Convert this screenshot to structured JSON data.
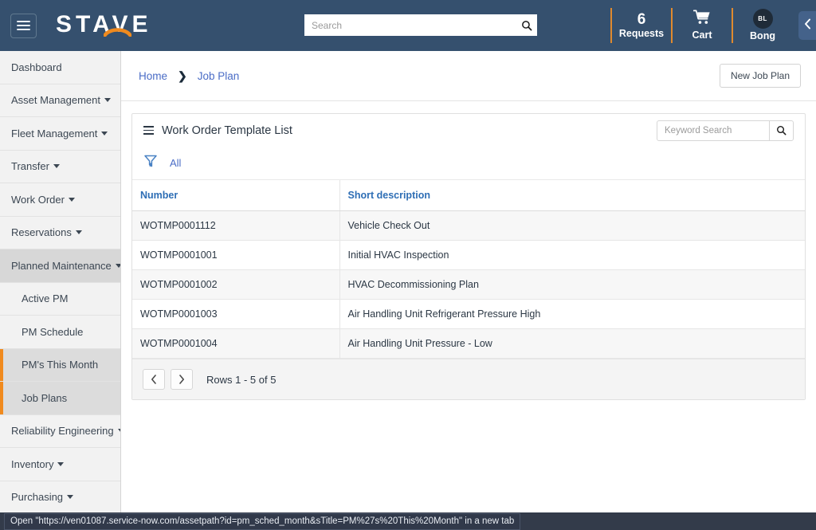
{
  "header": {
    "menu_icon": "hamburger-icon",
    "brand": "STAVE",
    "search": {
      "value": "",
      "placeholder": "Search",
      "icon": "search-icon"
    },
    "requests": {
      "count": "6",
      "label": "Requests"
    },
    "cart": {
      "label": "Cart",
      "icon": "cart-icon"
    },
    "user": {
      "initials": "BL",
      "name": "Bong",
      "avatar": "avatar-icon"
    },
    "collapse_icon": "chevron-left-icon",
    "background_color": "#35506e",
    "accent_color": "#e08a2e"
  },
  "sidebar": {
    "items": [
      {
        "label": "Dashboard",
        "has_caret": false,
        "level": "top",
        "state": "normal"
      },
      {
        "label": "Asset Management",
        "has_caret": true,
        "level": "top",
        "state": "normal"
      },
      {
        "label": "Fleet Management",
        "has_caret": true,
        "level": "top",
        "state": "normal"
      },
      {
        "label": "Transfer",
        "has_caret": true,
        "level": "top",
        "state": "normal"
      },
      {
        "label": "Work Order",
        "has_caret": true,
        "level": "top",
        "state": "normal"
      },
      {
        "label": "Reservations",
        "has_caret": true,
        "level": "top",
        "state": "normal"
      },
      {
        "label": "Planned Maintenance",
        "has_caret": true,
        "level": "top",
        "state": "expanded"
      },
      {
        "label": "Active PM",
        "has_caret": false,
        "level": "sub",
        "state": "normal"
      },
      {
        "label": "PM Schedule",
        "has_caret": false,
        "level": "sub",
        "state": "normal"
      },
      {
        "label": "PM's This Month",
        "has_caret": false,
        "level": "sub",
        "state": "highlighted"
      },
      {
        "label": "Job Plans",
        "has_caret": false,
        "level": "sub",
        "state": "highlighted"
      },
      {
        "label": "Reliability Engineering",
        "has_caret": true,
        "level": "top",
        "state": "normal"
      },
      {
        "label": "Inventory",
        "has_caret": true,
        "level": "top",
        "state": "normal"
      },
      {
        "label": "Purchasing",
        "has_caret": true,
        "level": "top",
        "state": "normal"
      }
    ],
    "highlight_accent": "#f08a1e"
  },
  "breadcrumb": {
    "home": "Home",
    "separator": "❯",
    "current": "Job Plan",
    "link_color": "#4a6cc6"
  },
  "actions": {
    "new_job_plan": "New Job Plan"
  },
  "list_card": {
    "menu_icon": "list-menu-icon",
    "title": "Work Order Template List",
    "keyword_search": {
      "value": "",
      "placeholder": "Keyword Search",
      "icon": "search-icon"
    },
    "filter": {
      "icon": "funnel-filter-icon",
      "label": "All"
    },
    "columns": [
      {
        "key": "number",
        "label": "Number"
      },
      {
        "key": "short_description",
        "label": "Short description"
      }
    ],
    "rows": [
      {
        "number": "WOTMP0001112",
        "short_description": "Vehicle Check Out"
      },
      {
        "number": "WOTMP0001001",
        "short_description": "Initial HVAC Inspection"
      },
      {
        "number": "WOTMP0001002",
        "short_description": "HVAC Decommissioning Plan"
      },
      {
        "number": "WOTMP0001003",
        "short_description": "Air Handling Unit Refrigerant Pressure High"
      },
      {
        "number": "WOTMP0001004",
        "short_description": "Air Handling Unit Pressure - Low"
      }
    ],
    "pagination": {
      "prev_icon": "chevron-left-icon",
      "next_icon": "chevron-right-icon",
      "summary": "Rows 1 - 5 of 5"
    },
    "header_link_color": "#2e6eb5"
  },
  "status_bar": {
    "text": "Open \"https://ven01087.service-now.com/assetpath?id=pm_sched_month&sTitle=PM%27s%20This%20Month\" in a new tab"
  }
}
